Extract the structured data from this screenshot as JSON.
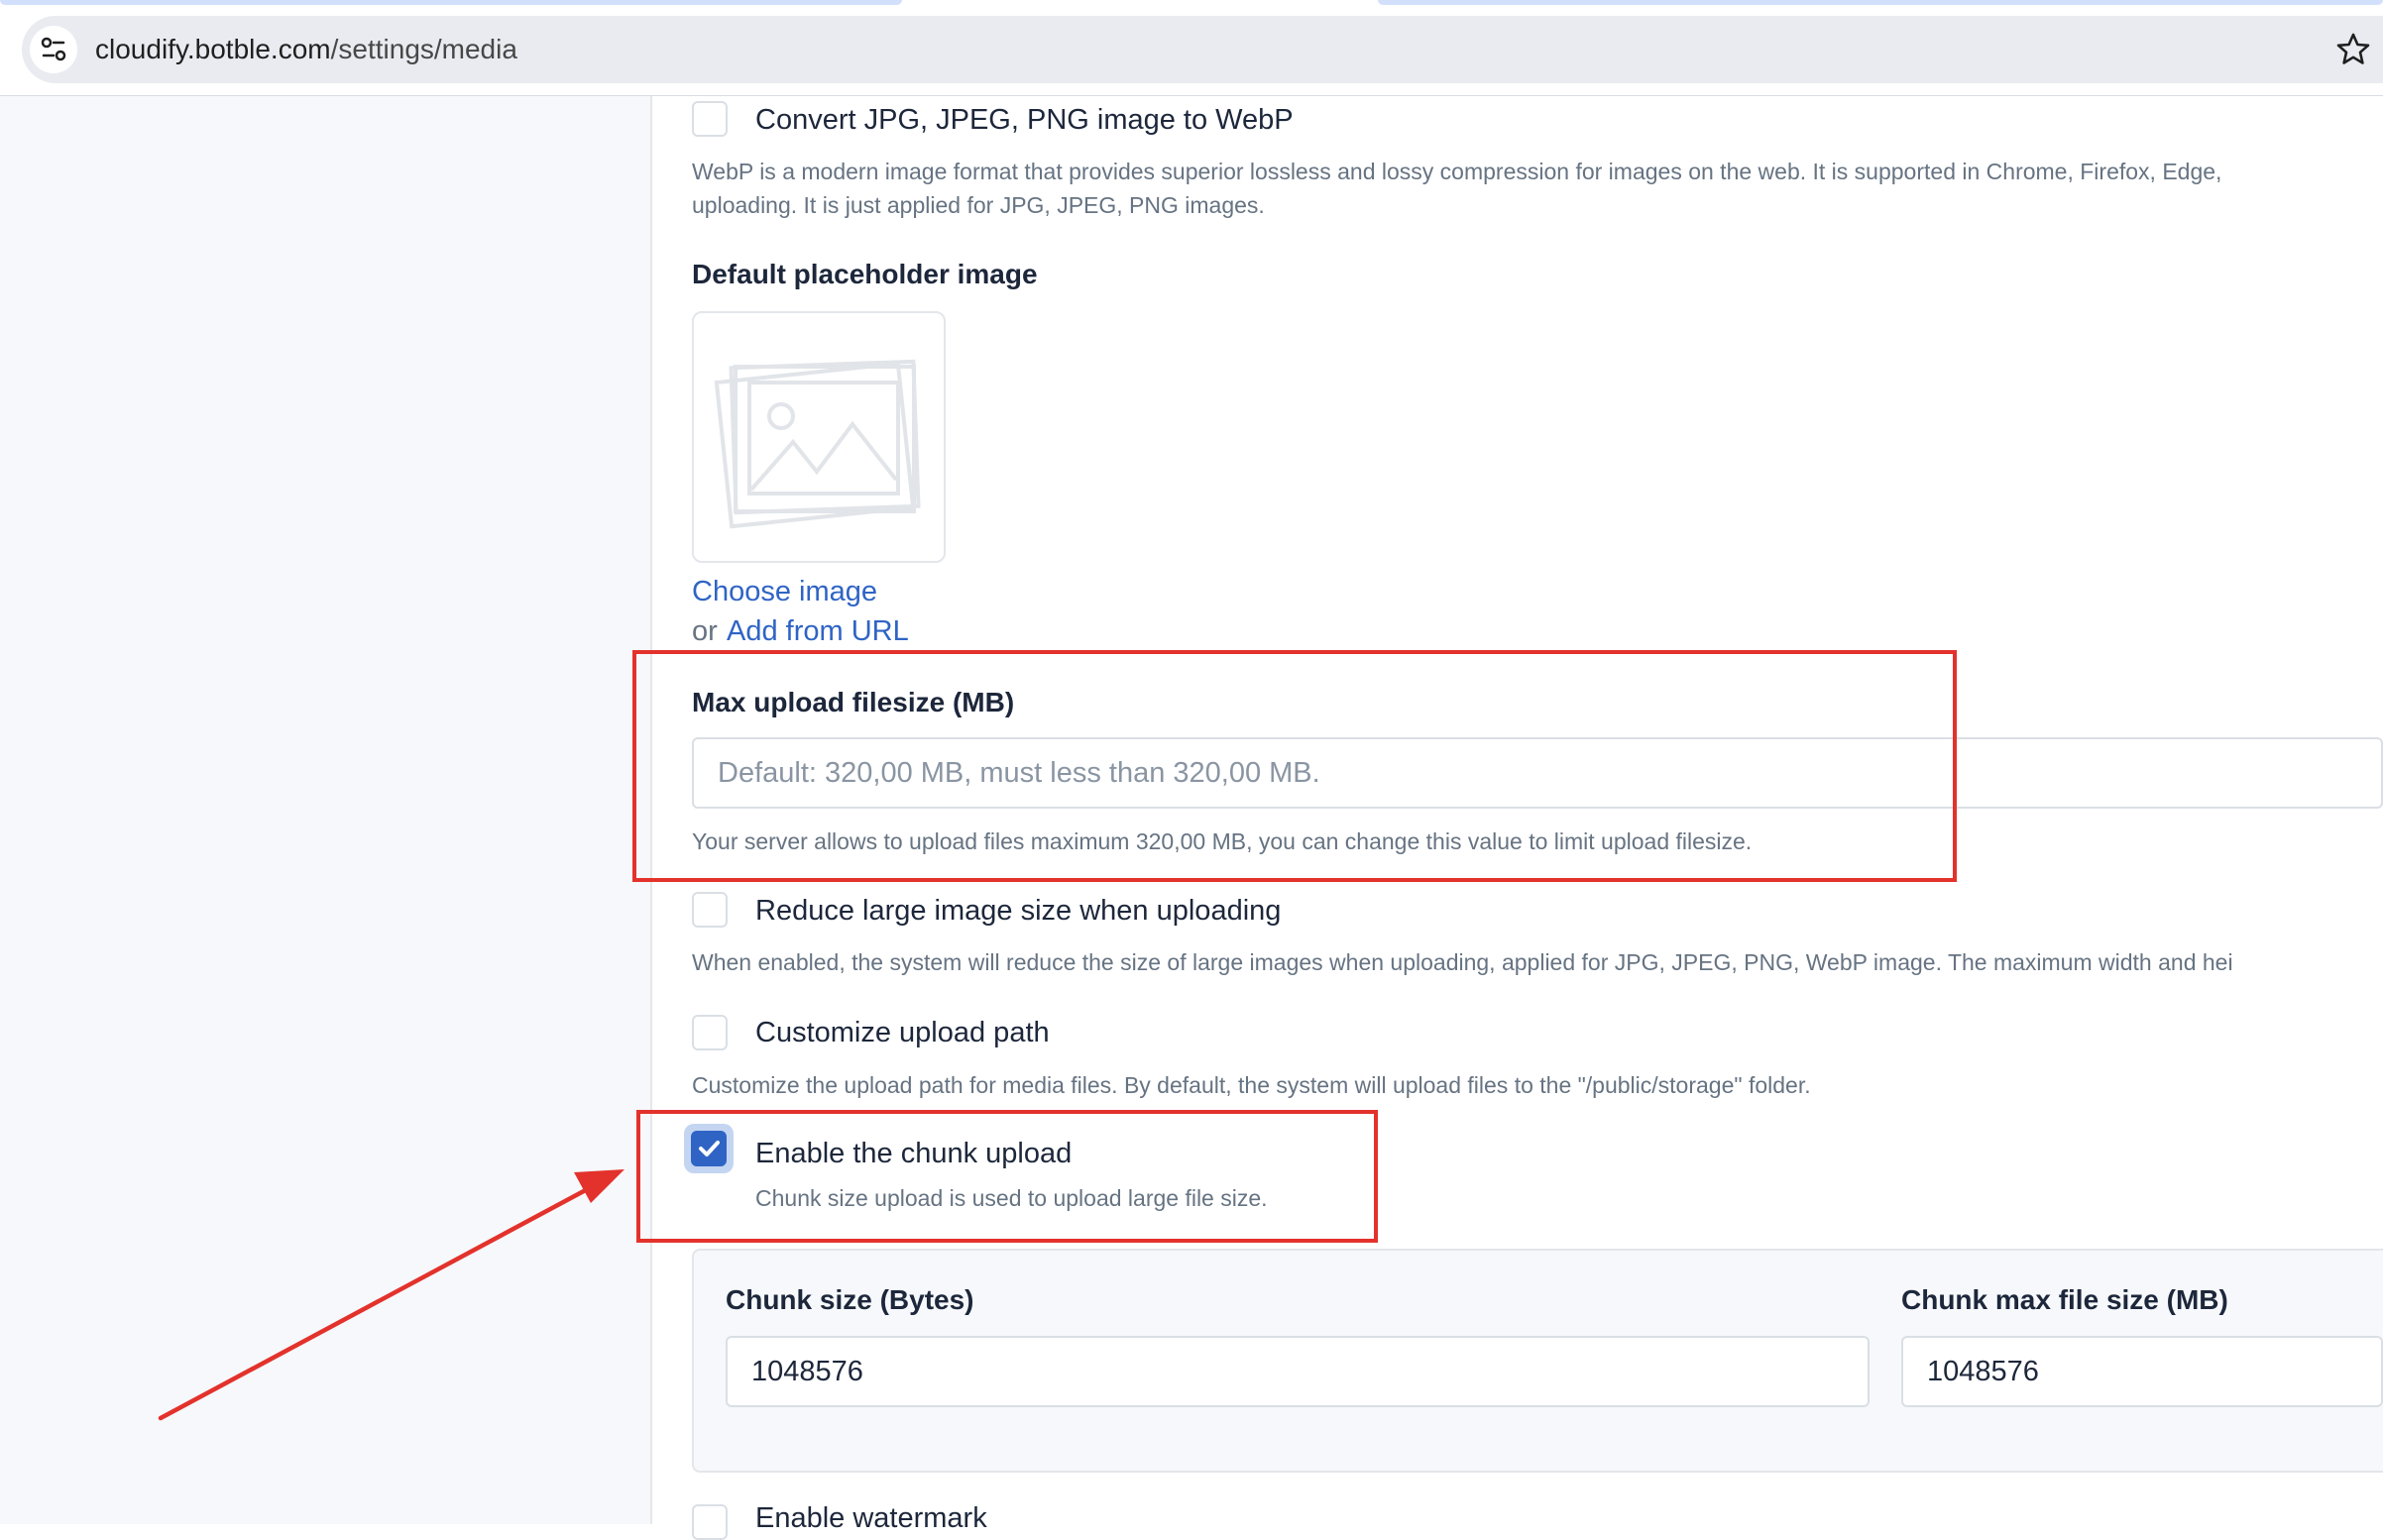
{
  "browser": {
    "url_domain": "cloudify.botble.com",
    "url_path": "/settings/media",
    "icons": [
      "site-settings-icon",
      "bookmark-star-icon"
    ]
  },
  "settings": {
    "convert_webp": {
      "label": "Convert JPG, JPEG, PNG image to WebP",
      "checked": false,
      "help_line1": "WebP is a modern image format that provides superior lossless and lossy compression for images on the web. It is supported in Chrome, Firefox, Edge,",
      "help_line2": "uploading. It is just applied for JPG, JPEG, PNG images."
    },
    "placeholder_image": {
      "label": "Default placeholder image",
      "choose_link": "Choose image",
      "or_text": "or",
      "url_link": "Add from URL",
      "icon": "image-placeholder-icon"
    },
    "max_upload": {
      "label": "Max upload filesize (MB)",
      "placeholder": "Default: 320,00 MB, must less than 320,00 MB.",
      "help": "Your server allows to upload files maximum 320,00 MB, you can change this value to limit upload filesize."
    },
    "reduce_size": {
      "label": "Reduce large image size when uploading",
      "checked": false,
      "help": "When enabled, the system will reduce the size of large images when uploading, applied for JPG, JPEG, PNG, WebP image. The maximum width and hei"
    },
    "custom_path": {
      "label": "Customize upload path",
      "checked": false,
      "help": "Customize the upload path for media files. By default, the system will upload files to the \"/public/storage\" folder."
    },
    "chunk_upload": {
      "label": "Enable the chunk upload",
      "checked": true,
      "help": "Chunk size upload is used to upload large file size.",
      "chunk_size_label": "Chunk size (Bytes)",
      "chunk_size_value": "1048576",
      "chunk_max_label": "Chunk max file size (MB)",
      "chunk_max_value": "1048576"
    },
    "watermark": {
      "label": "Enable watermark",
      "checked": false
    }
  },
  "annotation_colors": {
    "highlight": "#e3322c",
    "accent": "#2f64c5"
  }
}
